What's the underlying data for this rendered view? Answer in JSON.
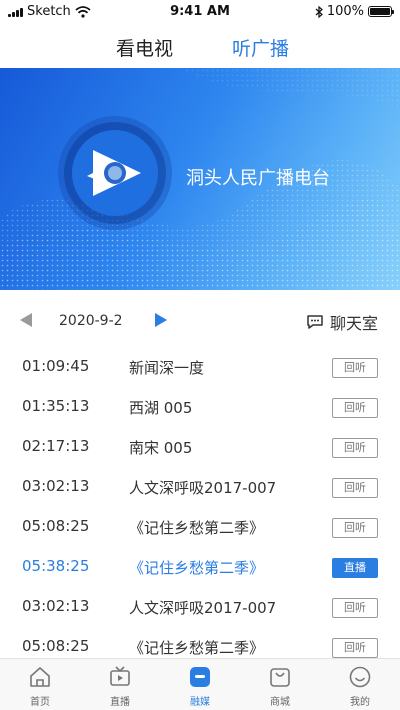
{
  "status_bar": {
    "carrier": "Sketch",
    "time": "9:41 AM",
    "battery": "100%"
  },
  "top_tabs": [
    {
      "label": "看电视",
      "active": false
    },
    {
      "label": "听广播",
      "active": true
    }
  ],
  "station": {
    "name": "洞头人民广播电台"
  },
  "date_nav": {
    "date": "2020-9-2",
    "chat_label": "聊天室"
  },
  "programs": [
    {
      "time": "01:09:45",
      "title": "新闻深一度",
      "action": "回听",
      "live": false
    },
    {
      "time": "01:35:13",
      "title": "西湖 005",
      "action": "回听",
      "live": false
    },
    {
      "time": "02:17:13",
      "title": "南宋 005",
      "action": "回听",
      "live": false
    },
    {
      "time": "03:02:13",
      "title": "人文深呼吸2017-007",
      "action": "回听",
      "live": false
    },
    {
      "time": "05:08:25",
      "title": "《记住乡愁第二季》",
      "action": "回听",
      "live": false
    },
    {
      "time": "05:38:25",
      "title": "《记住乡愁第二季》",
      "action": "直播",
      "live": true
    },
    {
      "time": "03:02:13",
      "title": "人文深呼吸2017-007",
      "action": "回听",
      "live": false
    },
    {
      "time": "05:08:25",
      "title": "《记住乡愁第二季》",
      "action": "回听",
      "live": false
    }
  ],
  "bottom_nav": [
    {
      "label": "首页",
      "icon": "home-icon",
      "active": false
    },
    {
      "label": "直播",
      "icon": "tv-icon",
      "active": false
    },
    {
      "label": "融媒",
      "icon": "media-icon",
      "active": true
    },
    {
      "label": "商城",
      "icon": "shopping-bag-icon",
      "active": false
    },
    {
      "label": "我的",
      "icon": "smiley-icon",
      "active": false
    }
  ],
  "colors": {
    "accent": "#2a7de1",
    "banner_start": "#1659d8",
    "banner_end": "#88d0fb"
  }
}
